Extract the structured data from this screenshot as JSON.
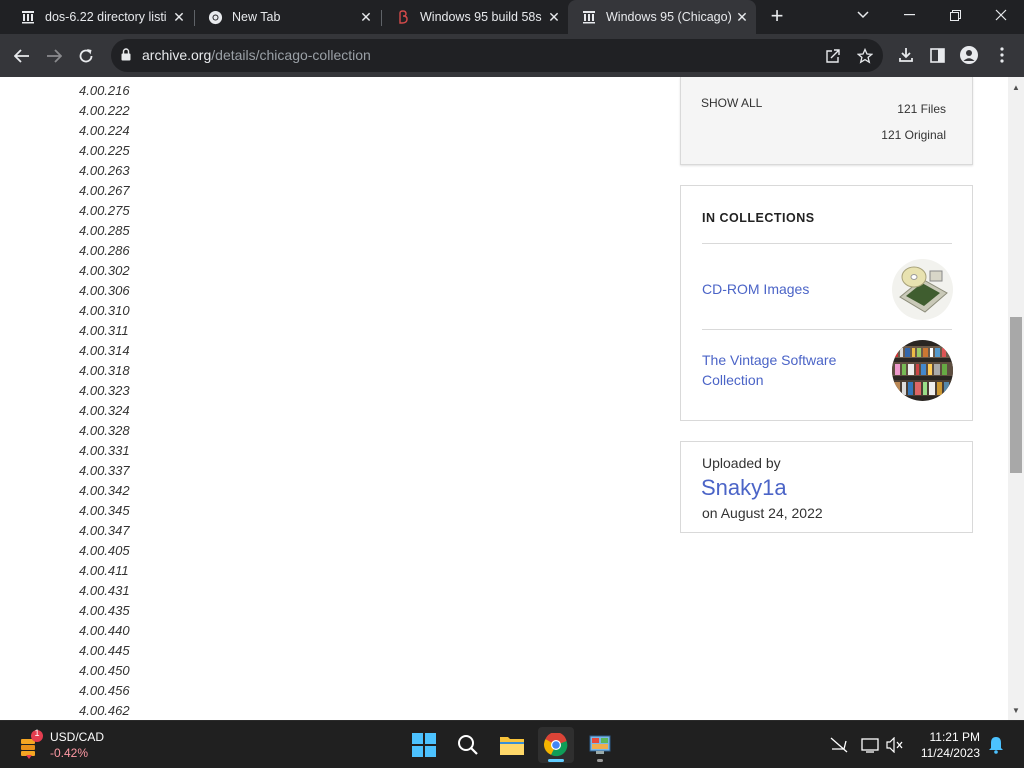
{
  "tabs": [
    {
      "title": "dos-6.22 directory listi",
      "icon": "archive-icon"
    },
    {
      "title": "New Tab",
      "icon": "chrome-icon"
    },
    {
      "title": "Windows 95 build 58s",
      "icon": "betawiki-icon"
    },
    {
      "title": "Windows 95 (Chicago)",
      "icon": "archive-icon",
      "active": true
    }
  ],
  "address": {
    "host": "archive.org",
    "path": "/details/chicago-collection"
  },
  "versions": [
    "4.00.216",
    "4.00.222",
    "4.00.224",
    "4.00.225",
    "4.00.263",
    "4.00.267",
    "4.00.275",
    "4.00.285",
    "4.00.286",
    "4.00.302",
    "4.00.306",
    "4.00.310",
    "4.00.311",
    "4.00.314",
    "4.00.318",
    "4.00.323",
    "4.00.324",
    "4.00.328",
    "4.00.331",
    "4.00.337",
    "4.00.342",
    "4.00.345",
    "4.00.347",
    "4.00.405",
    "4.00.411",
    "4.00.431",
    "4.00.435",
    "4.00.440",
    "4.00.445",
    "4.00.450",
    "4.00.456",
    "4.00.462"
  ],
  "files_panel": {
    "show_all": "SHOW ALL",
    "files": "121 Files",
    "original": "121 Original"
  },
  "collections": {
    "title": "IN COLLECTIONS",
    "items": [
      {
        "label": "CD-ROM Images",
        "icon": "cd-rom-thumbnail"
      },
      {
        "label": "The Vintage Software Collection",
        "icon": "vintage-software-thumbnail"
      }
    ]
  },
  "uploader": {
    "label": "Uploaded by",
    "name": "Snaky1a",
    "date": "on August 24, 2022"
  },
  "taskbar": {
    "ticker": "USD/CAD",
    "change": "-0.42%",
    "badge": "1",
    "time": "11:21 PM",
    "date": "11/24/2023"
  },
  "colors": {
    "link": "#4b64c7",
    "chrome_dark": "#202124",
    "chrome_toolbar": "#35363a"
  }
}
